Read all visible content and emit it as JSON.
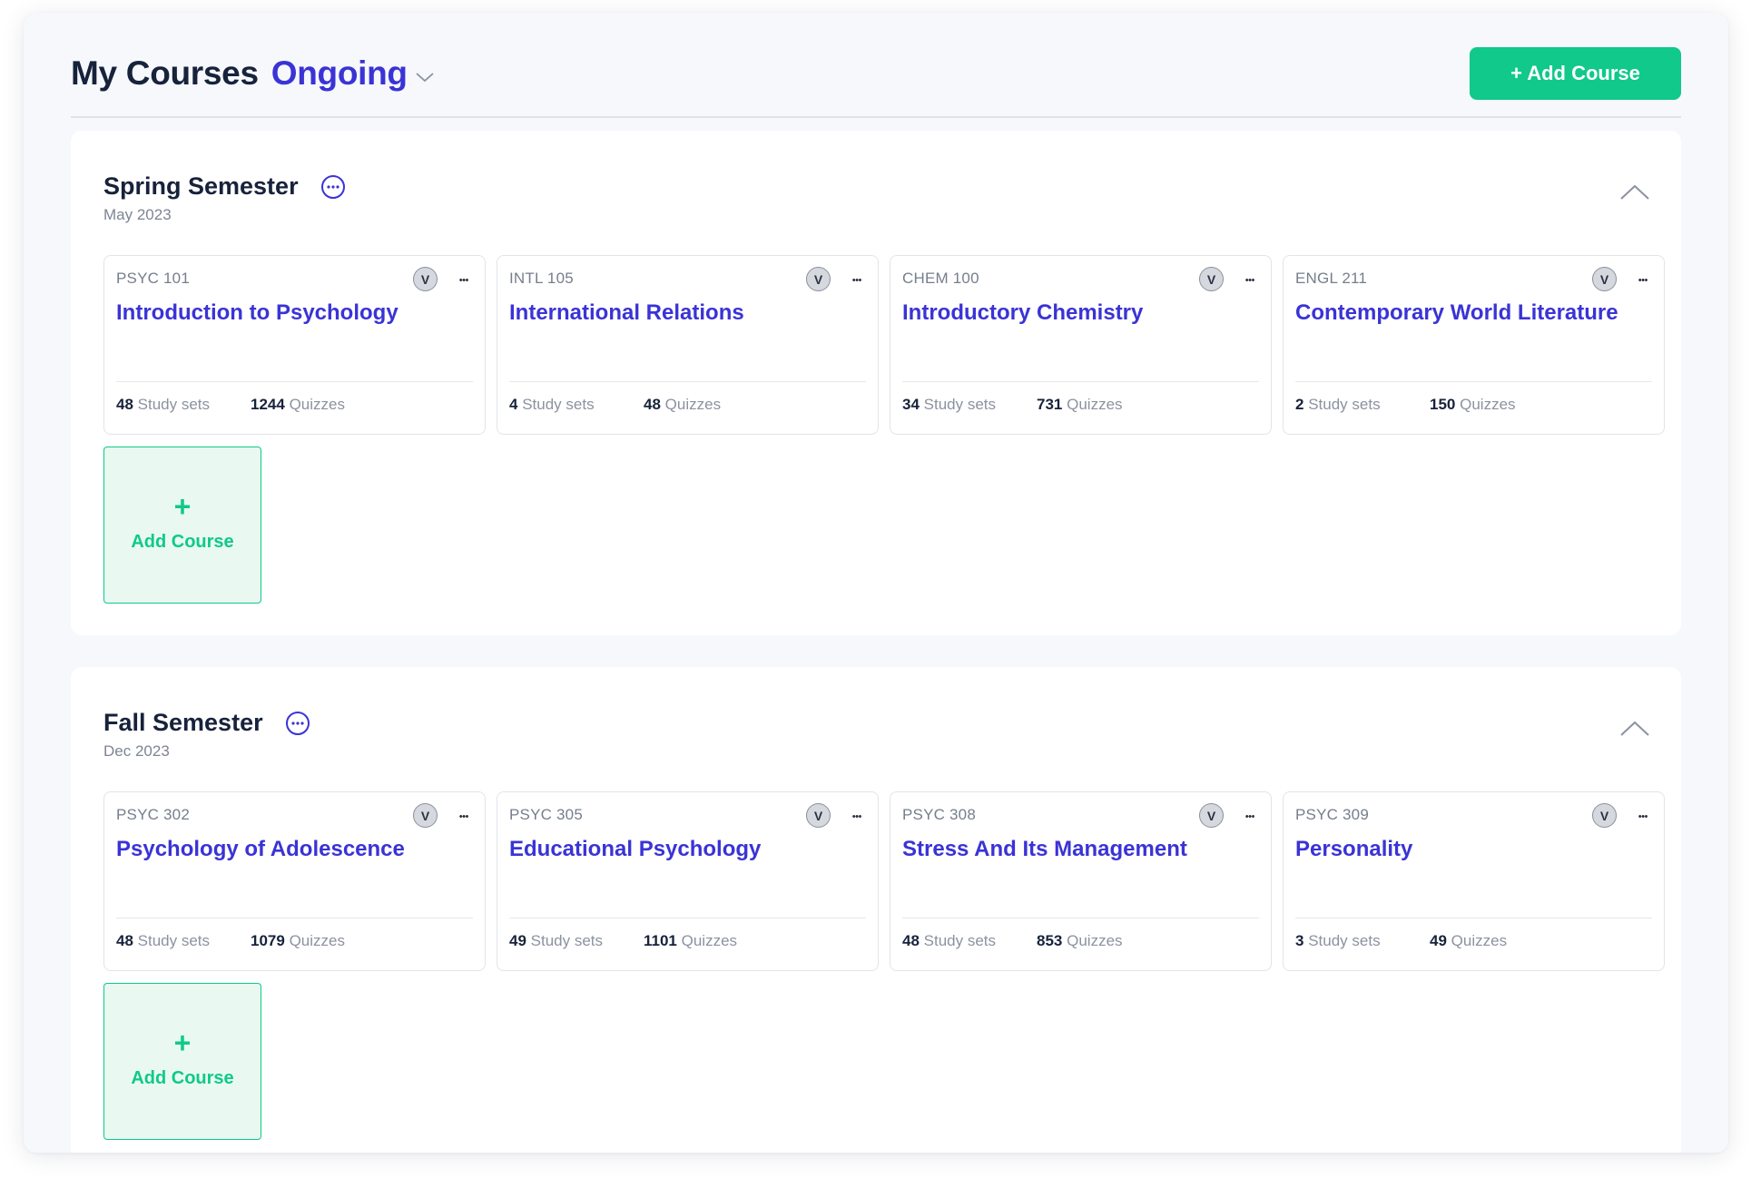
{
  "header": {
    "title": "My Courses",
    "filter_label": "Ongoing",
    "add_button_label": "+ Add Course"
  },
  "colors": {
    "accent": "#3a33d6",
    "brand_green": "#10c98a",
    "text_dark": "#17223b"
  },
  "semesters": [
    {
      "title": "Spring Semester",
      "date": "May 2023",
      "add_tile": {
        "plus": "+",
        "label": "Add Course"
      },
      "courses": [
        {
          "code": "PSYC 101",
          "name": "Introduction to Psychology",
          "badge": "V",
          "study_sets_count": "48",
          "study_sets_label": "Study sets",
          "quizzes_count": "1244",
          "quizzes_label": "Quizzes"
        },
        {
          "code": "INTL 105",
          "name": "International Relations",
          "badge": "V",
          "study_sets_count": "4",
          "study_sets_label": "Study sets",
          "quizzes_count": "48",
          "quizzes_label": "Quizzes"
        },
        {
          "code": "CHEM 100",
          "name": "Introductory Chemistry",
          "badge": "V",
          "study_sets_count": "34",
          "study_sets_label": "Study sets",
          "quizzes_count": "731",
          "quizzes_label": "Quizzes"
        },
        {
          "code": "ENGL 211",
          "name": "Contemporary World Literature",
          "badge": "V",
          "study_sets_count": "2",
          "study_sets_label": "Study sets",
          "quizzes_count": "150",
          "quizzes_label": "Quizzes"
        }
      ]
    },
    {
      "title": "Fall Semester",
      "date": "Dec 2023",
      "add_tile": {
        "plus": "+",
        "label": "Add Course"
      },
      "courses": [
        {
          "code": "PSYC 302",
          "name": "Psychology of Adolescence",
          "badge": "V",
          "study_sets_count": "48",
          "study_sets_label": "Study sets",
          "quizzes_count": "1079",
          "quizzes_label": "Quizzes"
        },
        {
          "code": "PSYC 305",
          "name": "Educational Psychology",
          "badge": "V",
          "study_sets_count": "49",
          "study_sets_label": "Study sets",
          "quizzes_count": "1101",
          "quizzes_label": "Quizzes"
        },
        {
          "code": "PSYC 308",
          "name": "Stress And Its Management",
          "badge": "V",
          "study_sets_count": "48",
          "study_sets_label": "Study sets",
          "quizzes_count": "853",
          "quizzes_label": "Quizzes"
        },
        {
          "code": "PSYC 309",
          "name": "Personality",
          "badge": "V",
          "study_sets_count": "3",
          "study_sets_label": "Study sets",
          "quizzes_count": "49",
          "quizzes_label": "Quizzes"
        }
      ]
    }
  ]
}
